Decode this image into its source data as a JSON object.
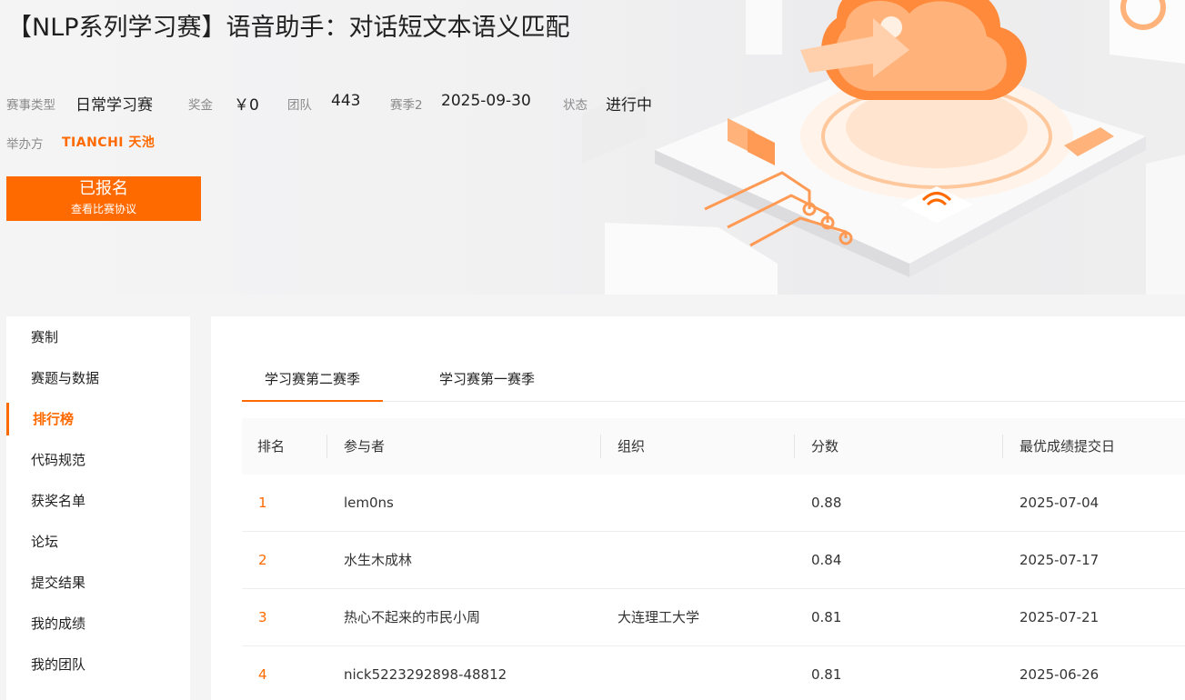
{
  "page": {
    "title": "【NLP系列学习赛】语音助手：对话短文本语义匹配"
  },
  "meta": {
    "type_label": "赛事类型",
    "type_value": "日常学习赛",
    "prize_label": "奖金",
    "prize_value": "￥0",
    "team_label": "团队",
    "team_value": "443",
    "season_label": "赛季2",
    "season_value": "2025-09-30",
    "status_label": "状态",
    "status_value": "进行中",
    "host_label": "举办方",
    "host_logo_text": "TIANCHI 天池"
  },
  "signup": {
    "main_label": "已报名",
    "sub_label": "查看比赛协议"
  },
  "sidebar": {
    "items": [
      {
        "label": "赛制",
        "active": false
      },
      {
        "label": "赛题与数据",
        "active": false
      },
      {
        "label": "排行榜",
        "active": true
      },
      {
        "label": "代码规范",
        "active": false
      },
      {
        "label": "获奖名单",
        "active": false
      },
      {
        "label": "论坛",
        "active": false
      },
      {
        "label": "提交结果",
        "active": false
      },
      {
        "label": "我的成绩",
        "active": false
      },
      {
        "label": "我的团队",
        "active": false
      }
    ]
  },
  "tabs": [
    {
      "label": "学习赛第二赛季",
      "active": true
    },
    {
      "label": "学习赛第一赛季",
      "active": false
    }
  ],
  "leaderboard": {
    "headers": [
      "排名",
      "参与者",
      "组织",
      "分数",
      "最优成绩提交日"
    ],
    "rows": [
      {
        "rank": "1",
        "participant": "lem0ns",
        "org": "",
        "score": "0.88",
        "date": "2025-07-04"
      },
      {
        "rank": "2",
        "participant": "水生木成林",
        "org": "",
        "score": "0.84",
        "date": "2025-07-17"
      },
      {
        "rank": "3",
        "participant": "热心不起来的市民小周",
        "org": "大连理工大学",
        "score": "0.81",
        "date": "2025-07-21"
      },
      {
        "rank": "4",
        "participant": "nick5223292898-48812",
        "org": "",
        "score": "0.81",
        "date": "2025-06-26"
      }
    ]
  },
  "colors": {
    "accent": "#ff6a00",
    "background": "#f4f4f5"
  }
}
